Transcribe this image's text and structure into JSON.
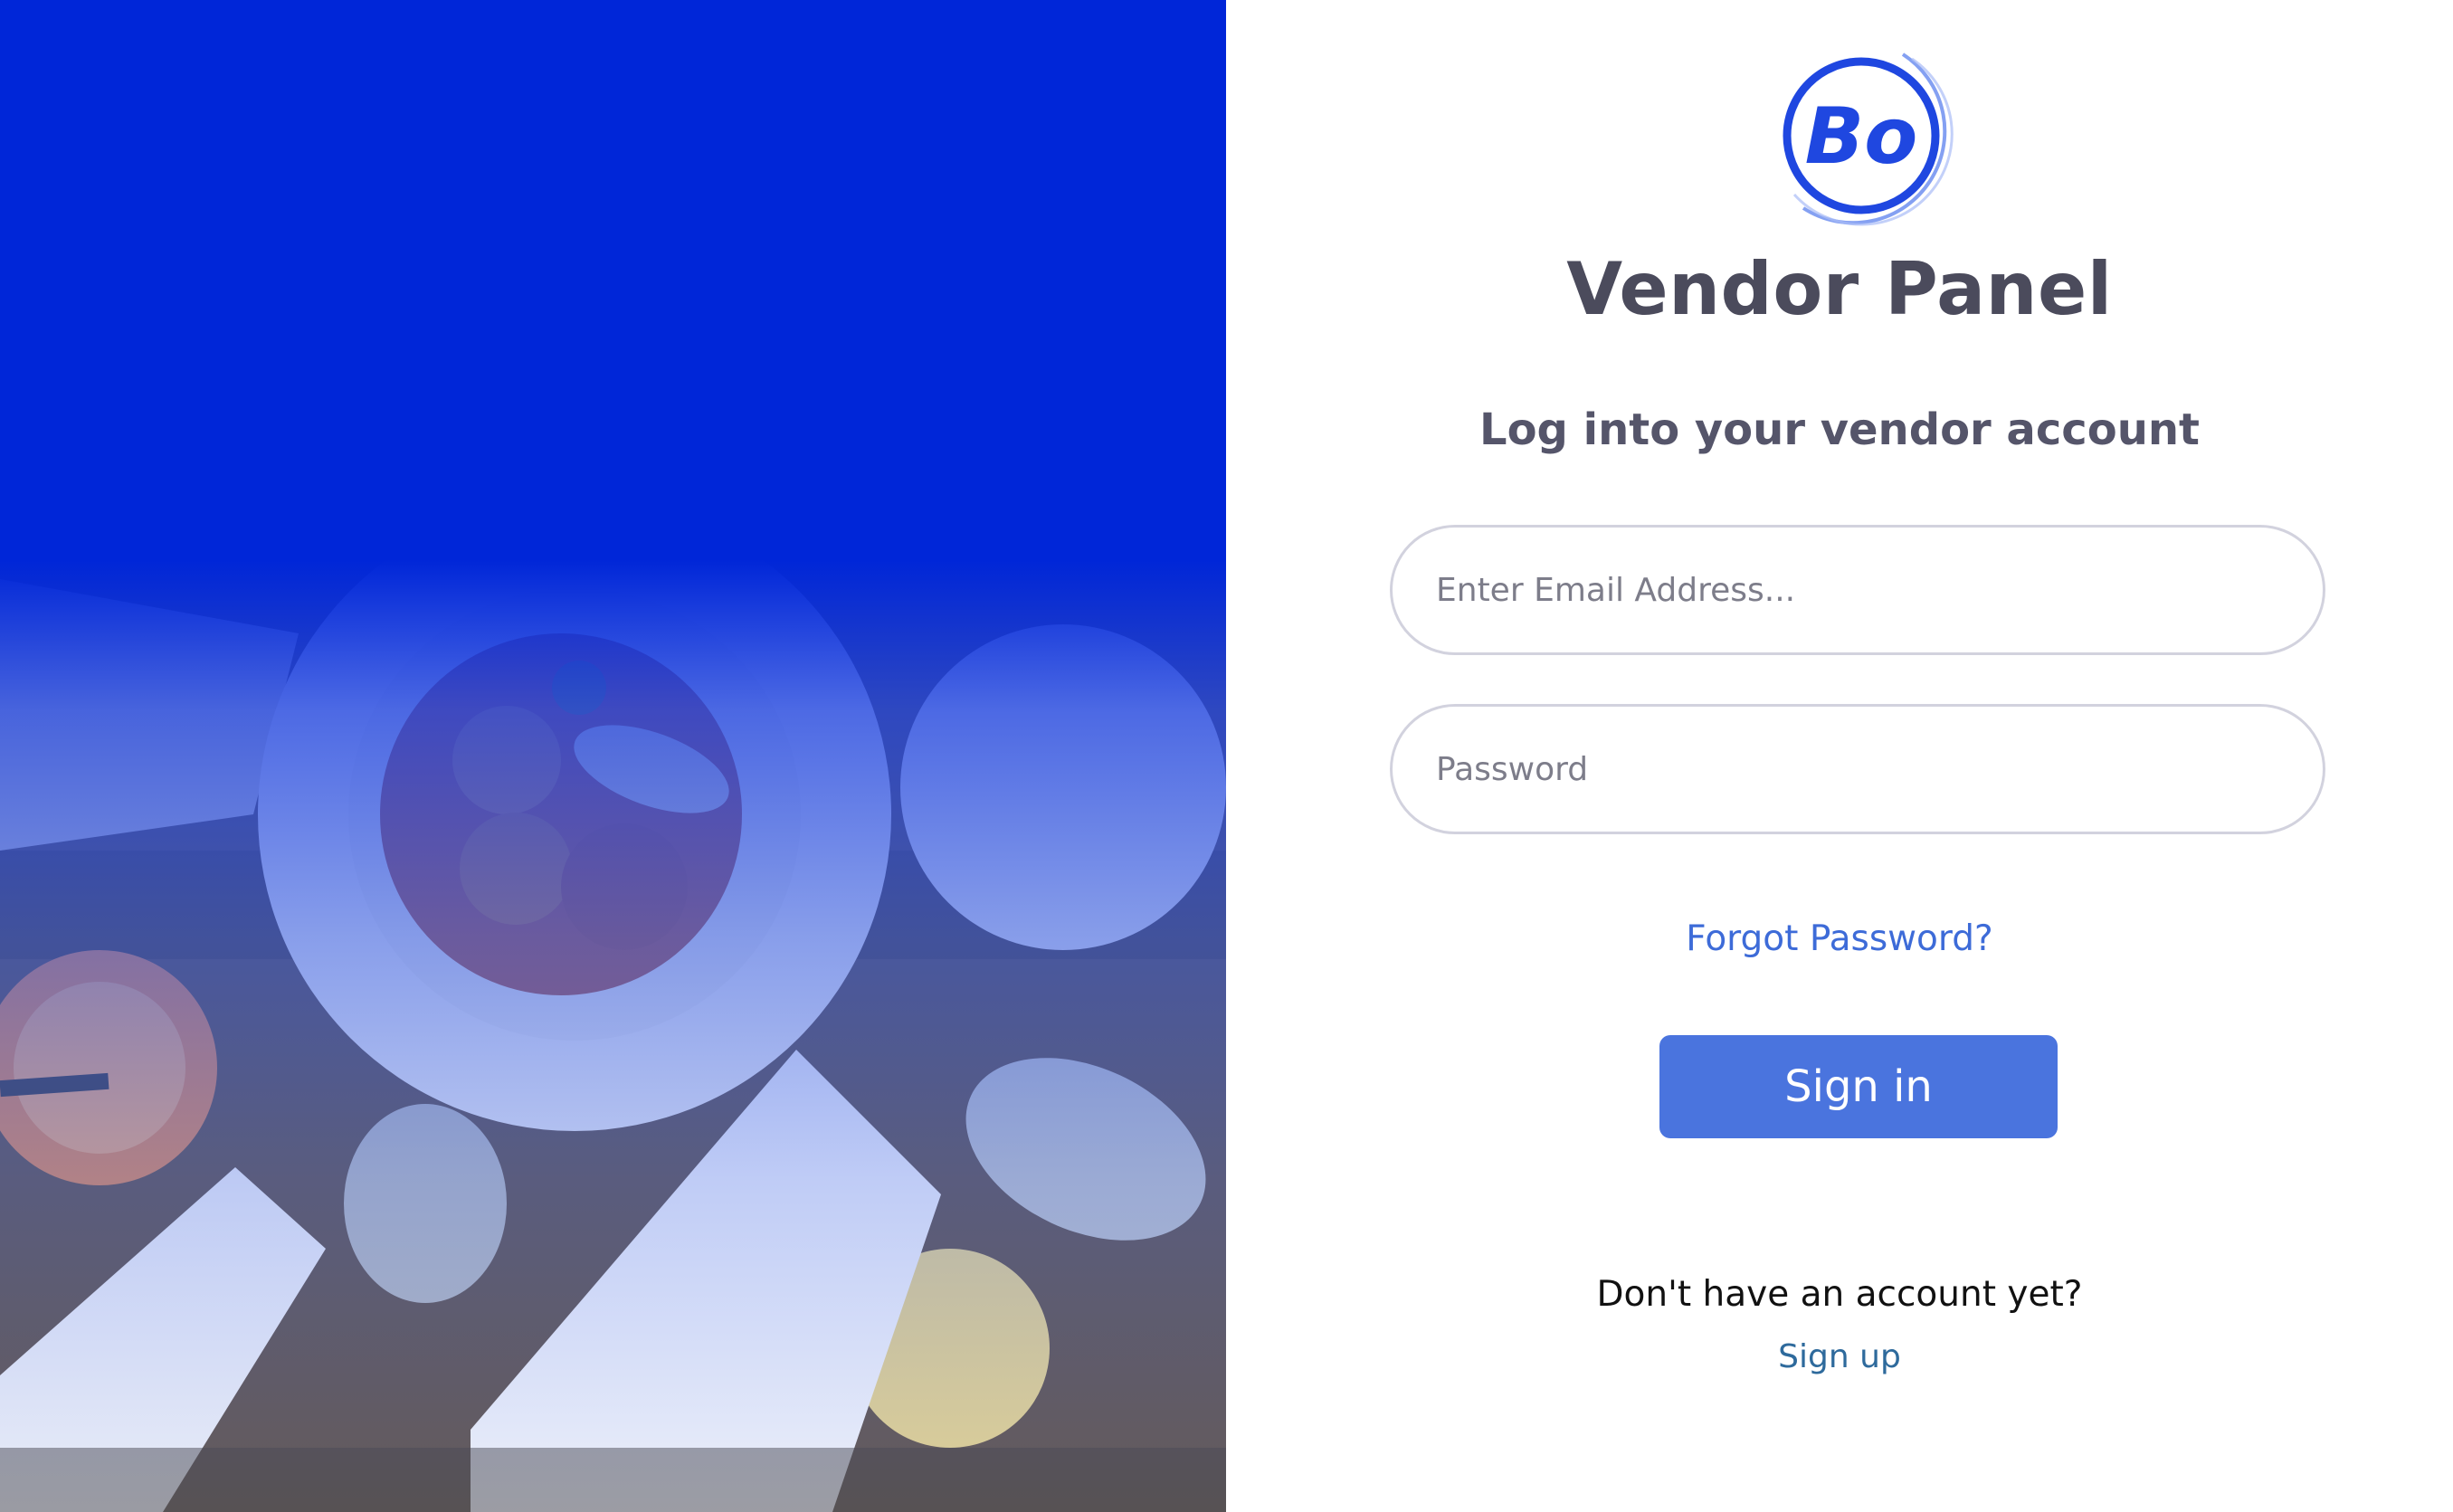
{
  "brand": {
    "logo_text": "Bo",
    "accent_color": "#1f47e0",
    "hero_overlay_color": "#0026d8"
  },
  "header": {
    "title": "Vendor Panel",
    "subtitle": "Log into your vendor account"
  },
  "form": {
    "email_placeholder": "Enter Email Address...",
    "email_value": "",
    "password_placeholder": "Password",
    "password_value": "",
    "forgot_label": "Forgot Password?",
    "signin_label": "Sign in",
    "signin_color": "#4a74de"
  },
  "footer": {
    "no_account_text": "Don't have an account yet?",
    "signup_label": "Sign up"
  },
  "hero": {
    "image_subject": "restaurant-table-food-photo"
  }
}
